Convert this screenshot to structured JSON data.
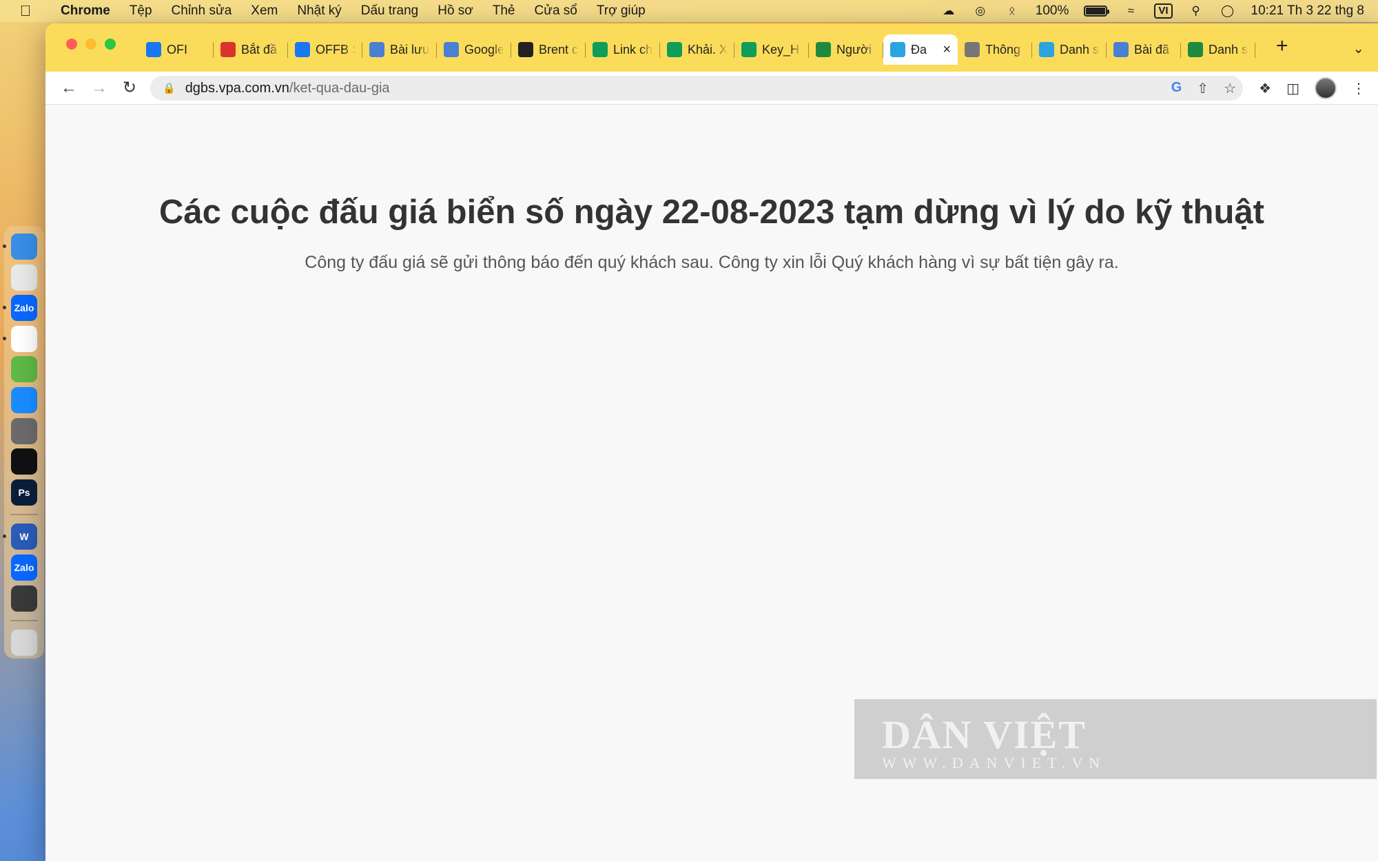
{
  "menubar": {
    "app_name": "Chrome",
    "items": [
      "Tệp",
      "Chỉnh sửa",
      "Xem",
      "Nhật ký",
      "Dấu trang",
      "Hồ sơ",
      "Thẻ",
      "Cửa sổ",
      "Trợ giúp"
    ],
    "battery_percent": "100%",
    "battery_level": 1.0,
    "input_source": "VI",
    "clock": "10:21 Th 3 22 thg 8"
  },
  "tabs": [
    {
      "title": "OFI",
      "favicon": "facebook-icon",
      "color": "#1877f2"
    },
    {
      "title": "Bắt đầ",
      "favicon": "emblem-icon",
      "color": "#d9342b"
    },
    {
      "title": "OFFB S",
      "favicon": "facebook-icon",
      "color": "#1877f2"
    },
    {
      "title": "Bài lưu",
      "favicon": "chart-icon",
      "color": "#4a7fd4"
    },
    {
      "title": "Google",
      "favicon": "google-sheets-icon",
      "color": "#4a7fd4"
    },
    {
      "title": "Brent c",
      "favicon": "te-icon",
      "color": "#222222"
    },
    {
      "title": "Link ch",
      "favicon": "sheets-plus-icon",
      "color": "#0f9d58"
    },
    {
      "title": "Khải. X",
      "favicon": "sheets-plus-icon",
      "color": "#0f9d58"
    },
    {
      "title": "Key_H",
      "favicon": "sheets-plus-icon",
      "color": "#0f9d58"
    },
    {
      "title": "Người",
      "favicon": "house-icon",
      "color": "#1e8a3e"
    },
    {
      "title": "Đa",
      "favicon": "vpa-icon",
      "color": "#2aa3e0",
      "active": true
    },
    {
      "title": "Thông",
      "favicon": "globe-icon",
      "color": "#777777"
    },
    {
      "title": "Danh s",
      "favicon": "vpa-icon",
      "color": "#2aa3e0"
    },
    {
      "title": "Bài đã",
      "favicon": "chart-icon",
      "color": "#4a7fd4"
    },
    {
      "title": "Danh s",
      "favicon": "house-icon",
      "color": "#1e8a3e"
    }
  ],
  "address_bar": {
    "host": "dgbs.vpa.com.vn",
    "path": "/ket-qua-dau-gia"
  },
  "page": {
    "headline": "Các cuộc đấu giá biển số ngày 22-08-2023 tạm dừng vì lý do kỹ thuật",
    "subtext": "Công ty đấu giá sẽ gửi thông báo đến quý khách sau. Công ty xin lỗi Quý khách hàng vì sự bất tiện gây ra."
  },
  "watermark": {
    "logo": "DÂN VIỆT",
    "url": "WWW.DANVIET.VN"
  },
  "dock": {
    "apps": [
      {
        "name": "finder-icon",
        "color": "#3a8ee6"
      },
      {
        "name": "launchpad-icon",
        "color": "#e8e8e8"
      },
      {
        "name": "zalo-icon",
        "label": "Zalo",
        "color": "#0a68ff"
      },
      {
        "name": "chrome-icon",
        "color": "#ffffff"
      },
      {
        "name": "coccoc-icon",
        "color": "#5fb946"
      },
      {
        "name": "app-store-icon",
        "color": "#1a8cff"
      },
      {
        "name": "system-settings-icon",
        "color": "#6b6b6b"
      },
      {
        "name": "capcut-icon",
        "color": "#111111"
      },
      {
        "name": "photoshop-icon",
        "label": "Ps",
        "color": "#0a1e3c"
      },
      {
        "name": "word-icon",
        "label": "W",
        "color": "#2b5cb8"
      },
      {
        "name": "zalo-icon",
        "label": "Zalo",
        "color": "#0a68ff"
      },
      {
        "name": "preview-icon",
        "color": "#3a3a3a"
      },
      {
        "name": "trash-icon",
        "color": "#d8d8d8"
      }
    ]
  }
}
